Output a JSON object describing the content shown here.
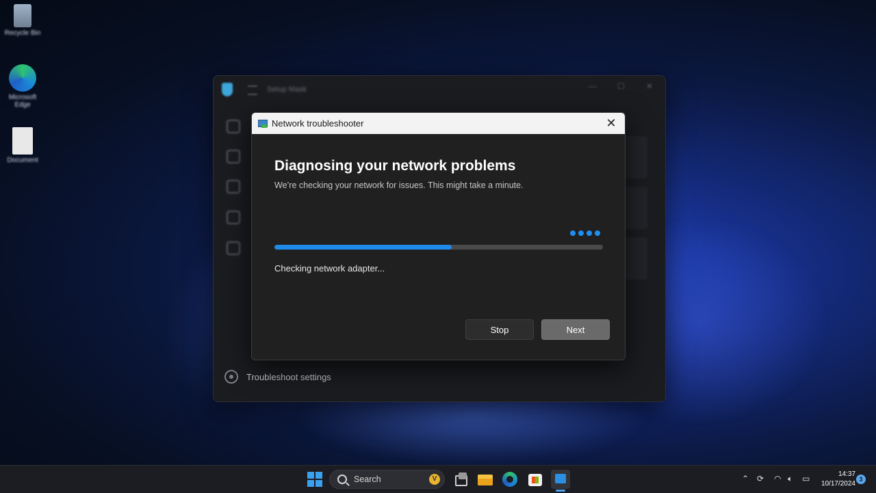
{
  "desktop": {
    "icons": [
      {
        "name": "Recycle Bin"
      },
      {
        "name": "Microsoft Edge"
      },
      {
        "name": "Document"
      }
    ]
  },
  "background_window": {
    "title": "Setup Mask",
    "settings_label": "Troubleshoot settings"
  },
  "dialog": {
    "title": "Network troubleshooter",
    "heading": "Diagnosing your network problems",
    "subtitle": "We’re checking your network for issues. This might take a minute.",
    "progress_fraction": 0.54,
    "status": "Checking network adapter...",
    "stop_label": "Stop",
    "next_label": "Next",
    "accent_color": "#1f8be8"
  },
  "taskbar": {
    "search_placeholder": "Search",
    "clock_time": "14:37",
    "clock_date": "10/17/2024",
    "notification_count": "3"
  }
}
